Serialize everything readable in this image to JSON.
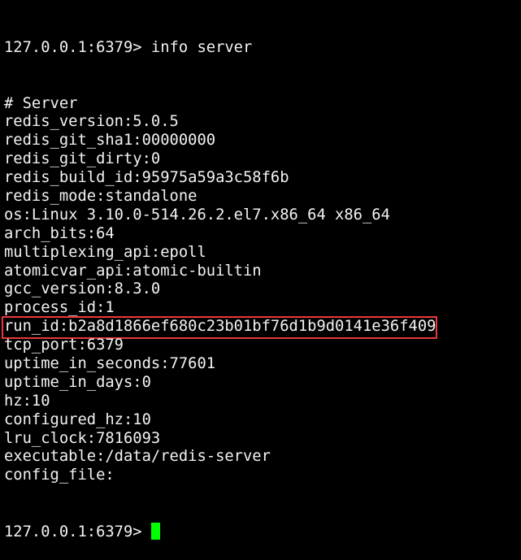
{
  "terminal": {
    "prompt": "127.0.0.1:6379> ",
    "command": "info server",
    "output": [
      "# Server",
      "redis_version:5.0.5",
      "redis_git_sha1:00000000",
      "redis_git_dirty:0",
      "redis_build_id:95975a59a3c58f6b",
      "redis_mode:standalone",
      "os:Linux 3.10.0-514.26.2.el7.x86_64 x86_64",
      "arch_bits:64",
      "multiplexing_api:epoll",
      "atomicvar_api:atomic-builtin",
      "gcc_version:8.3.0",
      "process_id:1",
      "run_id:b2a8d1866ef680c23b01bf76d1b9d0141e36f409",
      "tcp_port:6379",
      "uptime_in_seconds:77601",
      "uptime_in_days:0",
      "hz:10",
      "configured_hz:10",
      "lru_clock:7816093",
      "executable:/data/redis-server",
      "config_file:"
    ],
    "highlighted_line": 12,
    "highlight_color": "#e8383d",
    "cursor_color": "#00ff00"
  }
}
